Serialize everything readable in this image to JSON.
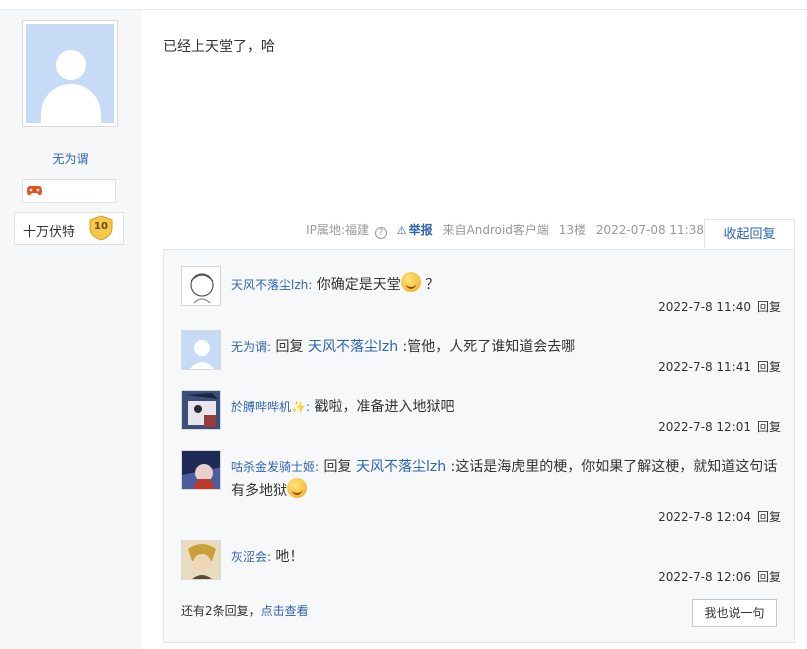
{
  "author": {
    "name": "无为谓",
    "level_title": "十万伏特",
    "level_num": "10"
  },
  "post": {
    "content": "已经上天堂了，哈",
    "ip_label": "IP属地:福建",
    "report_label": "举报",
    "source": "来自Android客户端",
    "floor": "13楼",
    "time": "2022-07-08 11:38",
    "collapse_label": "收起回复"
  },
  "replies": [
    {
      "user": "天风不落尘lzh:",
      "prefix": "",
      "target": "",
      "text": "你确定是天堂",
      "suffix": "？",
      "time": "2022-7-8 11:40",
      "reply_label": "回复"
    },
    {
      "user": "无为谓:",
      "prefix": "回复",
      "target": "天风不落尘lzh",
      "text": ":管他，人死了谁知道会去哪",
      "suffix": "",
      "time": "2022-7-8 11:41",
      "reply_label": "回复"
    },
    {
      "user": "於膊哔哔机✨:",
      "prefix": "",
      "target": "",
      "text": "戳啦，准备进入地狱吧",
      "suffix": "",
      "time": "2022-7-8 12:01",
      "reply_label": "回复"
    },
    {
      "user": "咕杀金发骑士姬:",
      "prefix": "回复",
      "target": "天风不落尘lzh",
      "text": ":这话是海虎里的梗，你如果了解这梗，就知道这句话有多地狱",
      "suffix": "",
      "time": "2022-7-8 12:04",
      "reply_label": "回复"
    },
    {
      "user": "灰涩会:",
      "prefix": "",
      "target": "",
      "text": "吔！",
      "suffix": "",
      "time": "2022-7-8 12:06",
      "reply_label": "回复"
    }
  ],
  "more": {
    "count_text": "还有2条回复，",
    "link_text": "点击查看",
    "say_button": "我也说一句"
  }
}
